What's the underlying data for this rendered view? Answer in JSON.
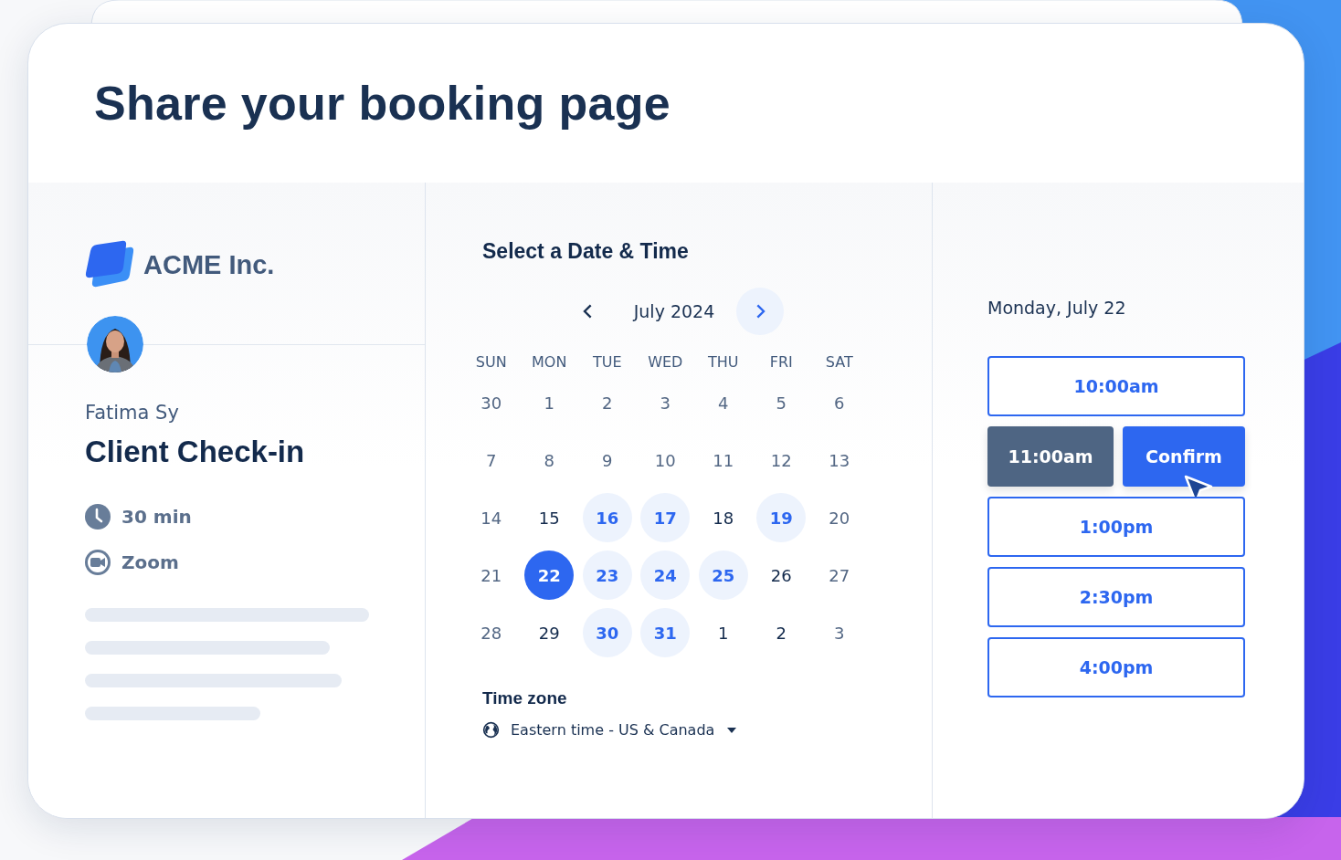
{
  "title": "Share your booking page",
  "host": {
    "company": "ACME Inc.",
    "name": "Fatima Sy",
    "event": "Client Check-in",
    "details": [
      {
        "kind": "duration",
        "label": "30 min"
      },
      {
        "kind": "video",
        "label": "Zoom"
      }
    ]
  },
  "calendar": {
    "heading": "Select a Date & Time",
    "month": "July 2024",
    "weekdays": [
      "SUN",
      "MON",
      "TUE",
      "WED",
      "THU",
      "FRI",
      "SAT"
    ],
    "days": [
      {
        "label": "30",
        "kind": "past",
        "selected": false
      },
      {
        "label": "1",
        "kind": "past",
        "selected": false
      },
      {
        "label": "2",
        "kind": "past",
        "selected": false
      },
      {
        "label": "3",
        "kind": "past",
        "selected": false
      },
      {
        "label": "4",
        "kind": "past",
        "selected": false
      },
      {
        "label": "5",
        "kind": "past",
        "selected": false
      },
      {
        "label": "6",
        "kind": "past",
        "selected": false
      },
      {
        "label": "7",
        "kind": "past",
        "selected": false
      },
      {
        "label": "8",
        "kind": "past",
        "selected": false
      },
      {
        "label": "9",
        "kind": "past",
        "selected": false
      },
      {
        "label": "10",
        "kind": "past",
        "selected": false
      },
      {
        "label": "11",
        "kind": "past",
        "selected": false
      },
      {
        "label": "12",
        "kind": "past",
        "selected": false
      },
      {
        "label": "13",
        "kind": "past",
        "selected": false
      },
      {
        "label": "14",
        "kind": "past",
        "selected": false
      },
      {
        "label": "15",
        "kind": "busy",
        "selected": false
      },
      {
        "label": "16",
        "kind": "available",
        "selected": false
      },
      {
        "label": "17",
        "kind": "available",
        "selected": false
      },
      {
        "label": "18",
        "kind": "busy",
        "selected": false
      },
      {
        "label": "19",
        "kind": "available",
        "selected": false
      },
      {
        "label": "20",
        "kind": "past",
        "selected": false
      },
      {
        "label": "21",
        "kind": "past",
        "selected": false
      },
      {
        "label": "22",
        "kind": "available",
        "selected": true
      },
      {
        "label": "23",
        "kind": "available",
        "selected": false
      },
      {
        "label": "24",
        "kind": "available",
        "selected": false
      },
      {
        "label": "25",
        "kind": "available",
        "selected": false
      },
      {
        "label": "26",
        "kind": "busy",
        "selected": false
      },
      {
        "label": "27",
        "kind": "past",
        "selected": false
      },
      {
        "label": "28",
        "kind": "past",
        "selected": false
      },
      {
        "label": "29",
        "kind": "busy",
        "selected": false
      },
      {
        "label": "30",
        "kind": "available",
        "selected": false
      },
      {
        "label": "31",
        "kind": "available",
        "selected": false
      },
      {
        "label": "1",
        "kind": "busy",
        "selected": false
      },
      {
        "label": "2",
        "kind": "busy",
        "selected": false
      },
      {
        "label": "3",
        "kind": "past",
        "selected": false
      }
    ],
    "timezone_label": "Time zone",
    "timezone": "Eastern time - US & Canada"
  },
  "slots": {
    "date": "Monday, July 22",
    "times": [
      {
        "label": "10:00am",
        "selected": false
      },
      {
        "label": "11:00am",
        "selected": true,
        "confirm": "Confirm"
      },
      {
        "label": "1:00pm",
        "selected": false
      },
      {
        "label": "2:30pm",
        "selected": false
      },
      {
        "label": "4:00pm",
        "selected": false
      }
    ]
  }
}
